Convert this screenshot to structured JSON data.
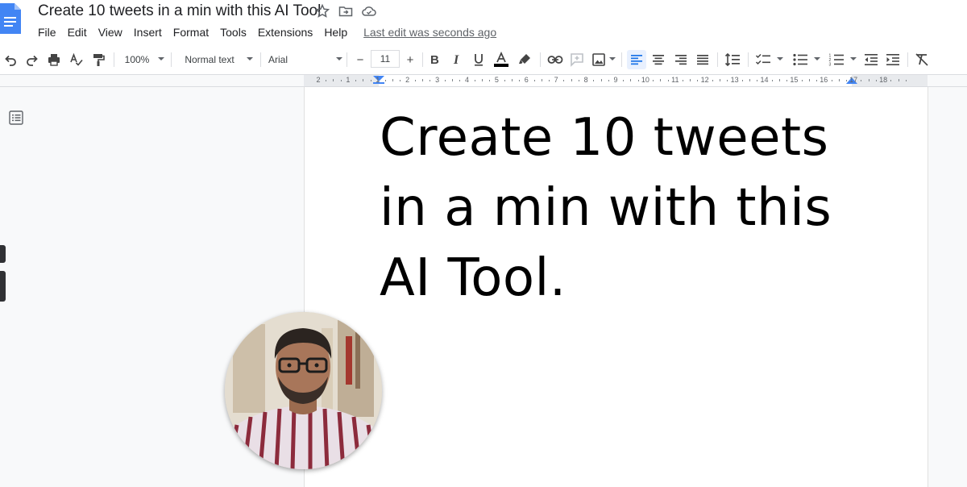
{
  "document": {
    "title": "Create 10 tweets in a min with this AI Tool",
    "last_edit": "Last edit was seconds ago",
    "heading_lines": [
      "Create 10 tweets",
      "in a min with this",
      "AI Tool."
    ]
  },
  "menu": [
    "File",
    "Edit",
    "View",
    "Insert",
    "Format",
    "Tools",
    "Extensions",
    "Help"
  ],
  "toolbar": {
    "zoom": "100%",
    "style": "Normal text",
    "font": "Arial",
    "font_size": "11",
    "minus": "−",
    "plus": "+"
  },
  "ruler": {
    "labels": [
      "2",
      "1",
      "1",
      "2",
      "3",
      "4",
      "5",
      "6",
      "7",
      "8",
      "9",
      "10",
      "11",
      "12",
      "13",
      "14",
      "15",
      "16",
      "17",
      "18"
    ]
  },
  "colors": {
    "accent": "#1a73e8",
    "doc_blue": "#4285f4",
    "text_color_bar": "#000000"
  },
  "icons": [
    "doc-logo-icon",
    "star-icon",
    "move-folder-icon",
    "cloud-saved-icon",
    "undo-icon",
    "redo-icon",
    "print-icon",
    "spellcheck-icon",
    "paint-format-icon",
    "bold-icon",
    "italic-icon",
    "underline-icon",
    "text-color-icon",
    "highlight-icon",
    "link-icon",
    "comment-icon",
    "image-icon",
    "align-left-icon",
    "align-center-icon",
    "align-right-icon",
    "justify-icon",
    "line-spacing-icon",
    "checklist-icon",
    "bulleted-list-icon",
    "numbered-list-icon",
    "decrease-indent-icon",
    "increase-indent-icon",
    "clear-format-icon",
    "outline-icon"
  ]
}
